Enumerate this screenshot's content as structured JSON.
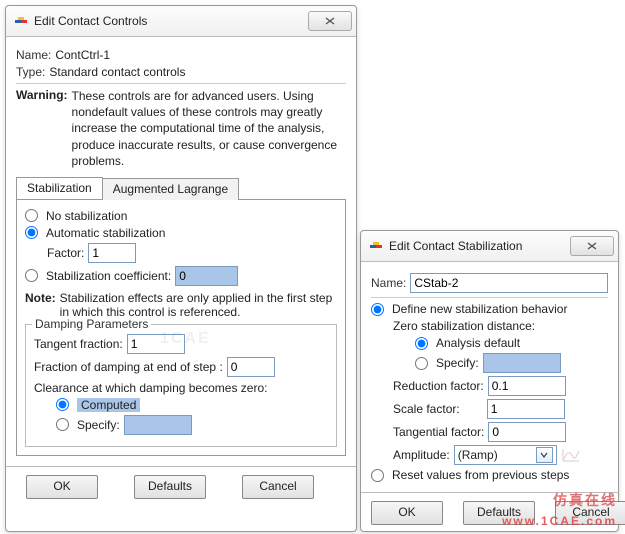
{
  "dialog1": {
    "title": "Edit Contact Controls",
    "name_label": "Name:",
    "name_value": "ContCtrl-1",
    "type_label": "Type:",
    "type_value": "Standard contact controls",
    "warning_label": "Warning:",
    "warning_text": "These controls are for advanced users. Using nondefault values of these controls may greatly increase the computational time of the analysis, produce inaccurate results, or cause convergence problems.",
    "tabs": {
      "stabilization": "Stabilization",
      "augmented": "Augmented Lagrange"
    },
    "stab": {
      "no_stab": "No stabilization",
      "auto_stab": "Automatic stabilization",
      "factor_label": "Factor:",
      "factor_value": "1",
      "coef_label": "Stabilization coefficient:",
      "coef_value": "0",
      "note_label": "Note:",
      "note_text": "Stabilization effects are only applied in the first step in which this control is referenced.",
      "damping_legend": "Damping Parameters",
      "tangent_label": "Tangent fraction:",
      "tangent_value": "1",
      "fracdamp_label": "Fraction of damping at end of step :",
      "fracdamp_value": "0",
      "clearance_label": "Clearance at which damping becomes zero:",
      "computed": "Computed",
      "specify": "Specify:",
      "specify_value": ""
    },
    "buttons": {
      "ok": "OK",
      "defaults": "Defaults",
      "cancel": "Cancel"
    }
  },
  "dialog2": {
    "title": "Edit Contact Stabilization",
    "name_label": "Name:",
    "name_value": "CStab-2",
    "define": "Define new stabilization behavior",
    "zero_label": "Zero stabilization distance:",
    "analysis_default": "Analysis default",
    "specify": "Specify:",
    "specify_value": "",
    "reduction_label": "Reduction factor:",
    "reduction_value": "0.1",
    "scale_label": "Scale factor:",
    "scale_value": "1",
    "tangential_label": "Tangential factor:",
    "tangential_value": "0",
    "amplitude_label": "Amplitude:",
    "amplitude_value": "(Ramp)",
    "reset": "Reset values from previous steps",
    "buttons": {
      "ok": "OK",
      "defaults": "Defaults",
      "cancel": "Cancel"
    }
  },
  "watermarks": {
    "bg": "1CAE",
    "brand": "仿真在线",
    "url": "www.1CAE.com"
  }
}
